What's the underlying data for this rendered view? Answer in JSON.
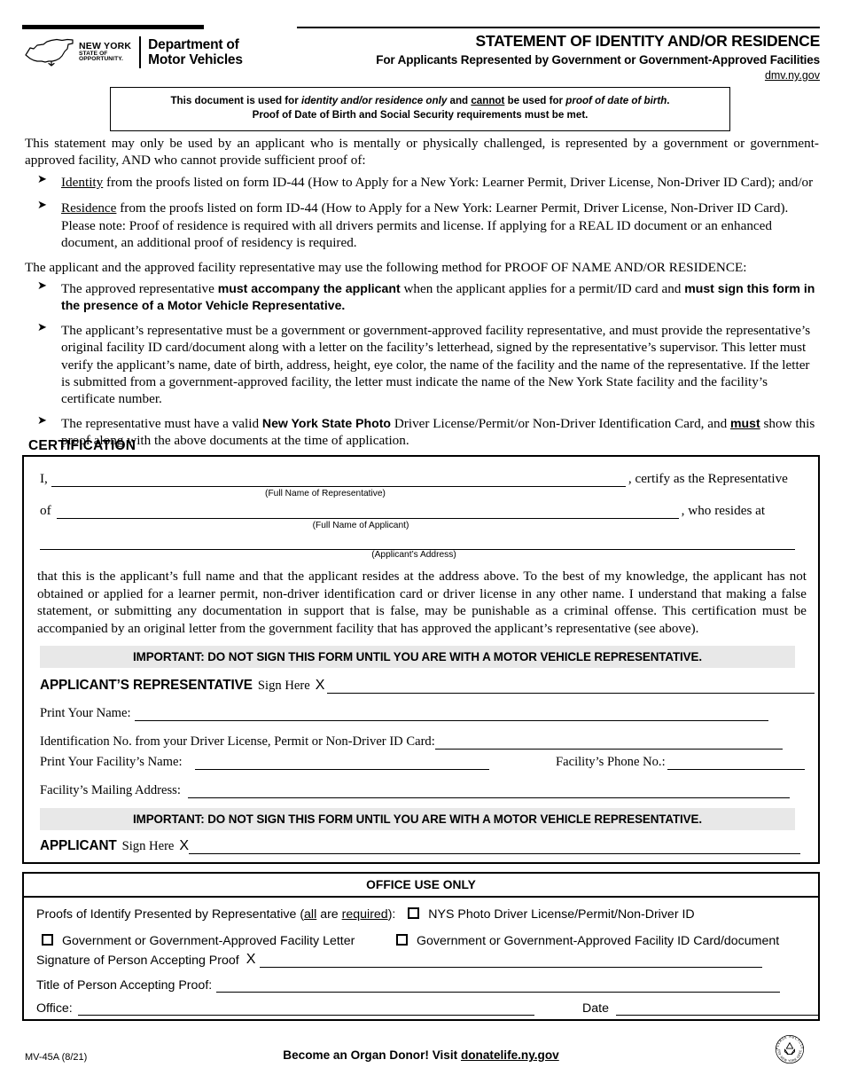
{
  "header": {
    "agency_state": "NEW YORK",
    "agency_tag1": "STATE OF",
    "agency_tag2": "OPPORTUNITY.",
    "agency_name_line1": "Department of",
    "agency_name_line2": "Motor Vehicles",
    "title": "STATEMENT OF IDENTITY AND/OR RESIDENCE",
    "subtitle": "For Applicants Represented by Government or Government-Approved Facilities",
    "url": "dmv.ny.gov"
  },
  "notice": {
    "line1_a": "This document is used for ",
    "line1_i1": "identity and/or residence only",
    "line1_b": " and ",
    "line1_u": "cannot",
    "line1_c": " be used for ",
    "line1_i2": "proof of date of birth",
    "line1_d": ".",
    "line2": "Proof of Date of Birth and Social Security requirements must be met."
  },
  "intro": "This statement may only be used by an applicant who is mentally or physically challenged, is represented by a government or government-approved facility, AND who cannot provide sufficient proof of:",
  "proof_bullets": [
    {
      "underlined": "Identity",
      "rest": " from the proofs listed on form ID-44 (How to Apply for a New York: Learner Permit, Driver License, Non-Driver ID Card); and/or"
    },
    {
      "underlined": "Residence",
      "rest": " from the proofs listed on form ID-44 (How to Apply for a New York: Learner Permit, Driver License, Non-Driver ID Card). Please note: Proof of residence is required with all drivers permits and license. If applying for a REAL ID document or an enhanced document, an additional proof of residency is required."
    }
  ],
  "method_intro": "The applicant and the approved facility representative may use the following method for PROOF OF NAME AND/OR RESIDENCE:",
  "method_bullets": {
    "b1_p1": "The approved representative ",
    "b1_bold1": "must accompany the applicant",
    "b1_p2": " when the applicant applies for a permit/ID card and ",
    "b1_bold2": "must sign this form in the presence of a Motor Vehicle Representative.",
    "b2": "The applicant’s representative must be a government or government-approved facility representative, and must provide the representative’s original facility ID card/document along with a letter on the facility’s letterhead, signed by the representative’s supervisor. This letter must verify the applicant’s name, date of birth, address, height, eye color, the name of the facility and the name of the representative. If the letter is submitted from a government-approved facility, the letter must indicate the name of the New York State facility and the facility’s certificate number.",
    "b3_p1": "The representative must have a valid ",
    "b3_bold": "New York State Photo",
    "b3_p2": " Driver License/Permit/or Non-Driver Identification Card, and ",
    "b3_under": "must",
    "b3_p3": " show this proof along with the above documents at the time of application."
  },
  "certification": {
    "section_label": "CERTIFICATION",
    "line_i": "I,",
    "certify_tail": ", certify as the Representative",
    "caption_rep": "(Full Name of Representative)",
    "line_of": "of",
    "resides_tail": ", who resides at",
    "caption_applicant": "(Full Name of Applicant)",
    "caption_address": "(Applicant’s Address)",
    "paragraph": "that this is the applicant’s full name and that the applicant resides at the address above. To the best of my knowledge, the applicant has not obtained or applied for a learner permit, non-driver identification card or driver license in any other name. I understand that making a false statement, or submitting any documentation in support that is false, may be punishable as a criminal offense. This certification must be accompanied by an original letter from the government facility that has approved the applicant’s representative (see above).",
    "important_bar_1": "IMPORTANT: DO NOT SIGN THIS FORM UNTIL YOU ARE WITH A MOTOR VEHICLE REPRESENTATIVE.",
    "rep_sign_label": "APPLICANT’S REPRESENTATIVE",
    "rep_sign_here": "Sign Here",
    "sign_x": "X",
    "print_name_label": "Print Your Name:",
    "id_no_label": "Identification No. from your Driver License, Permit or Non-Driver ID Card:",
    "facility_name_label": "Print Your Facility’s Name:",
    "facility_phone_label": "Facility’s Phone No.:",
    "facility_address_label": "Facility’s Mailing Address:",
    "important_bar_2": "IMPORTANT: DO NOT SIGN THIS FORM UNTIL YOU ARE WITH A MOTOR VEHICLE REPRESENTATIVE.",
    "applicant_sign_label": "APPLICANT",
    "applicant_sign_here": "Sign Here"
  },
  "office_use": {
    "title": "OFFICE USE ONLY",
    "proofs_p1": "Proofs of Identify Presented by Representative (",
    "proofs_u1": "all",
    "proofs_p2": " are ",
    "proofs_u2": "required",
    "proofs_p3": "):",
    "checkbox_1": "NYS Photo Driver License/Permit/Non-Driver ID",
    "checkbox_2": "Government or Government-Approved Facility Letter",
    "checkbox_3": "Government or Government-Approved Facility ID Card/document",
    "signature_label": "Signature of Person Accepting Proof",
    "sign_x": "X",
    "title_label": "Title of Person Accepting Proof:",
    "office_label": "Office:",
    "date_label": "Date"
  },
  "footer": {
    "form_id": "MV-45A (8/21)",
    "donor_text": "Become an Organ Donor! Visit ",
    "donor_url": "donatelife.ny.gov",
    "recycle_top": "PLEASE RECYCLE",
    "recycle_bottom": "KEEP NEW YORK GREEN"
  },
  "colors": {
    "ink": "#000000",
    "bar_gray": "#e8e8e8",
    "paper": "#ffffff"
  }
}
